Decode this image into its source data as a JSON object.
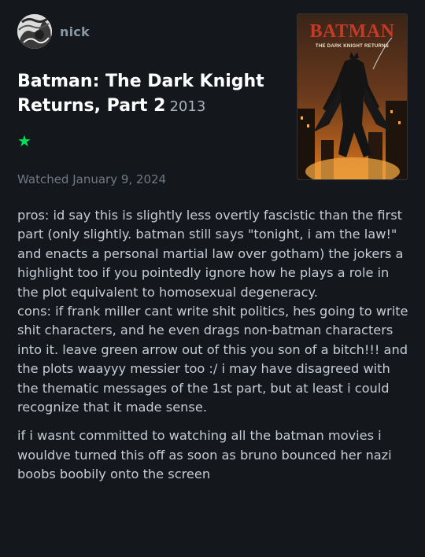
{
  "header": {
    "username": "nick",
    "avatar_icon": "avatar-image"
  },
  "film": {
    "title": "Batman: The Dark Knight Returns, Part 2",
    "year": "2013",
    "rating": "★",
    "rating_color": "#00e054",
    "watched": "Watched January 9, 2024"
  },
  "poster": {
    "title": "BATMAN",
    "subtitle": "THE DARK KNIGHT RETURNS"
  },
  "review": {
    "paragraphs": [
      "pros: id say this is slightly less overtly fascistic than the first part (only slightly. batman still says \"tonight, i am the law!\" and enacts a personal martial law over gotham) the jokers a highlight too if you pointedly ignore how he plays a role in the plot equivalent to homosexual degeneracy.\ncons: if frank miller cant write shit politics, hes going to write shit characters, and he even drags non-batman characters into it. leave green arrow out of this you son of a bitch!!! and the plots waayyy messier too :/ i may have disagreed with the thematic messages of the 1st part, but at least i could recognize that it made sense.",
      "if i wasnt committed to watching all the batman movies i wouldve turned this off as soon as bruno bounced her nazi boobs boobily onto the screen"
    ]
  }
}
